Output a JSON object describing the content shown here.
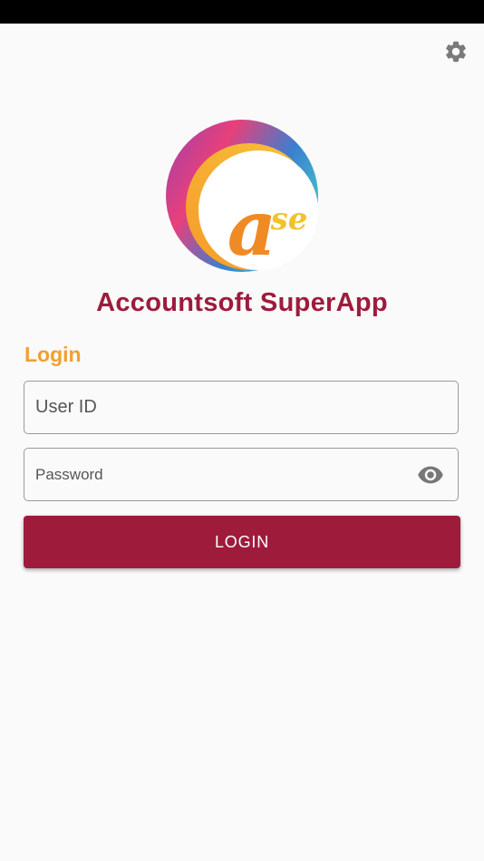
{
  "app": {
    "title": "Accountsoft SuperApp",
    "logo_text": "ase"
  },
  "header": {
    "settings_icon": "gear-icon"
  },
  "login": {
    "section_label": "Login",
    "user_id": {
      "value": "",
      "placeholder": "User ID"
    },
    "password": {
      "value": "",
      "placeholder": "Password",
      "toggle_icon": "eye-icon"
    },
    "submit_label": "LOGIN"
  },
  "colors": {
    "brand": "#9e1b3c",
    "accent": "#f0a030",
    "background": "#fafafa",
    "status_bar": "#000000"
  }
}
